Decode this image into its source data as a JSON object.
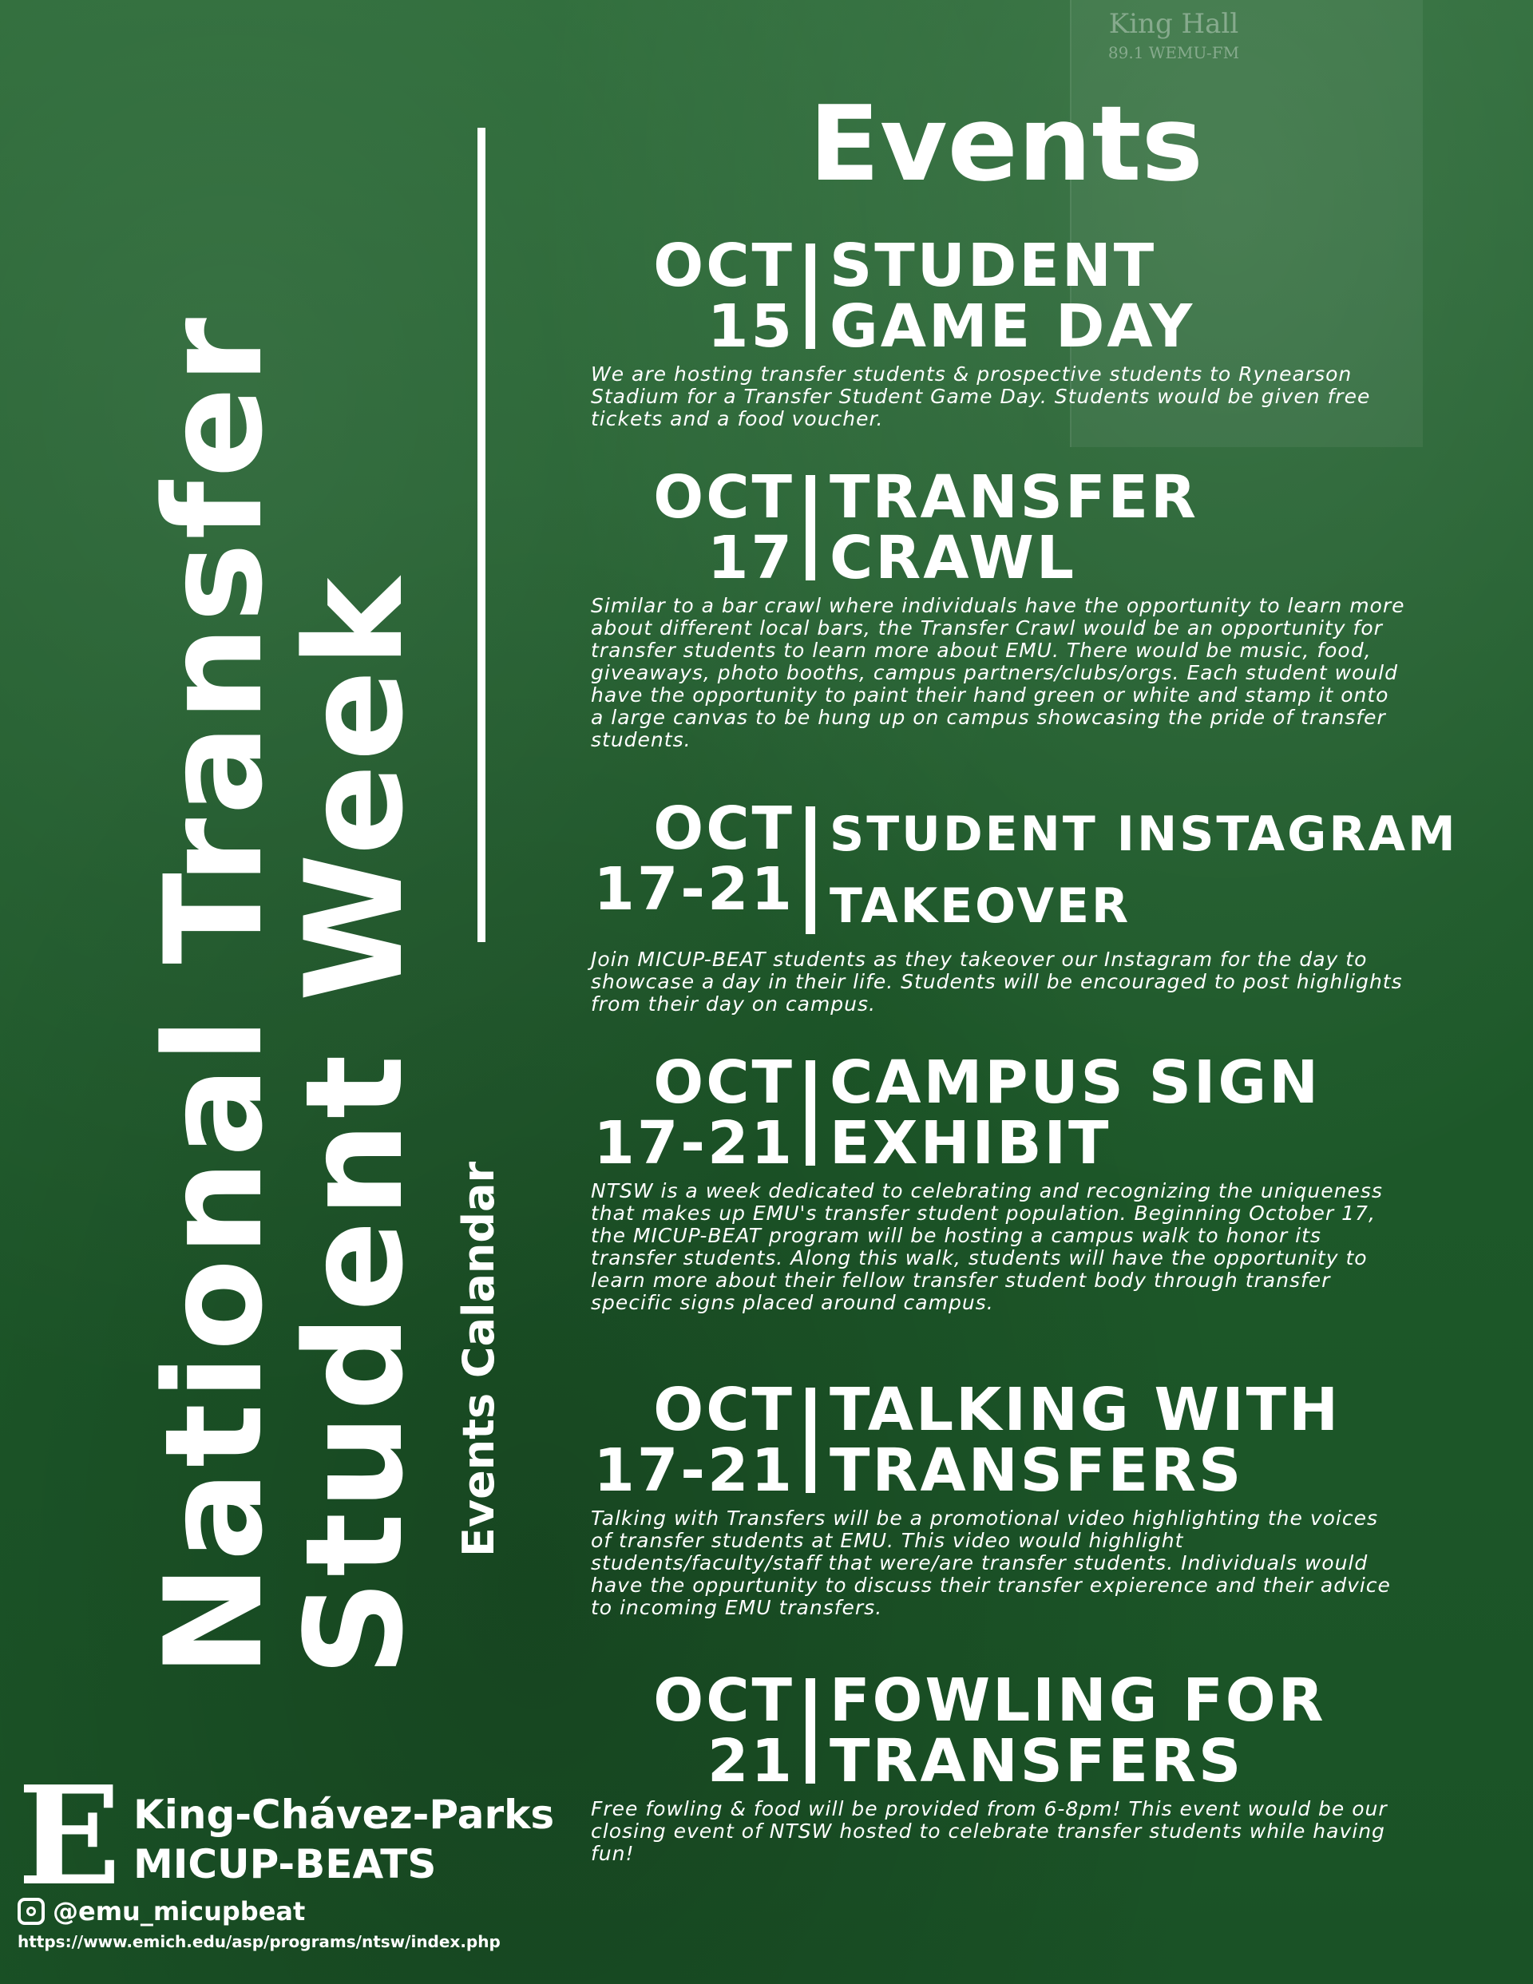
{
  "background_sign": {
    "line1": "King Hall",
    "line2": "89.1 WEMU-FM"
  },
  "title": {
    "line1": "National Transfer",
    "line2": "Student Week",
    "subtitle": "Events Calandar"
  },
  "events_heading": "Events",
  "events": [
    {
      "date_top": "OCT",
      "date_bottom": "15",
      "name_top": "STUDENT",
      "name_bottom": "GAME DAY",
      "description": "We are hosting transfer students & prospective students to Rynearson Stadium for a Transfer Student Game Day. Students would be given free tickets and a food voucher."
    },
    {
      "date_top": "OCT",
      "date_bottom": "17",
      "name_top": "TRANSFER",
      "name_bottom": "CRAWL",
      "description": "Similar to a bar crawl where individuals have the opportunity to learn more about different local bars, the Transfer Crawl would be an opportunity for transfer students to learn more about EMU. There would be music, food, giveaways, photo booths, campus partners/clubs/orgs. Each student would have the opportunity to paint their hand green or white and stamp it onto a large canvas to be hung up on campus showcasing the pride of transfer students."
    },
    {
      "date_top": "OCT",
      "date_bottom": "17-21",
      "name_top": "STUDENT INSTAGRAM",
      "name_bottom": "TAKEOVER",
      "description": "Join MICUP-BEAT students as they takeover our Instagram for the day to showcase a day in their life. Students will be encouraged to post highlights from their day on campus."
    },
    {
      "date_top": "OCT",
      "date_bottom": "17-21",
      "name_top": "CAMPUS SIGN",
      "name_bottom": "EXHIBIT",
      "description": "NTSW is a week dedicated to celebrating and recognizing the uniqueness that makes up EMU's transfer student population. Beginning October 17, the MICUP-BEAT program will be hosting a campus walk to honor its transfer students. Along this walk, students will have the opportunity to learn more about their fellow transfer student body through transfer specific signs placed around campus."
    },
    {
      "date_top": "OCT",
      "date_bottom": "17-21",
      "name_top": "TALKING WITH",
      "name_bottom": "TRANSFERS",
      "description": "Talking with Transfers will be a promotional video highlighting the voices of transfer students at EMU. This video would highlight students/faculty/staff that were/are transfer students. Individuals would have the oppurtunity to discuss their transfer expierence and their advice to incoming EMU transfers."
    },
    {
      "date_top": "OCT",
      "date_bottom": "21",
      "name_top": "FOWLING FOR",
      "name_bottom": "TRANSFERS",
      "description": "Free fowling & food will be provided from 6-8pm! This event would be our closing event of NTSW hosted to celebrate transfer students while having fun!"
    }
  ],
  "footer": {
    "logo_letter": "E",
    "org_line1": "King-Chávez-Parks",
    "org_line2": "MICUP-BEATS",
    "instagram_handle": "@emu_micupbeat",
    "url": "https://www.emich.edu/asp/programs/ntsw/index.php"
  }
}
